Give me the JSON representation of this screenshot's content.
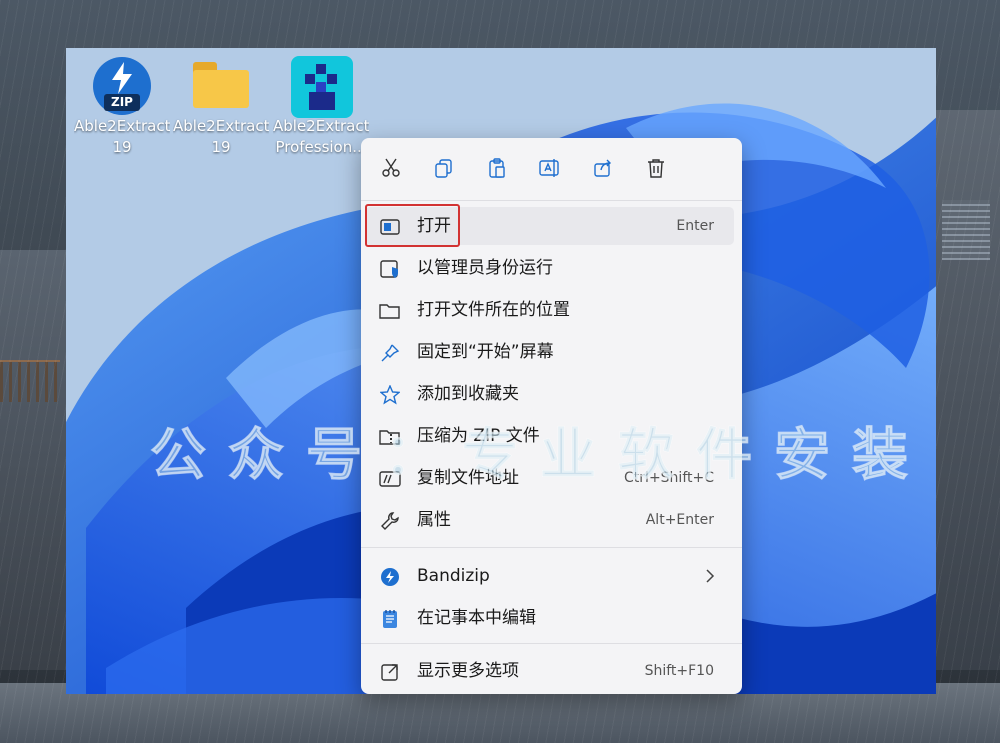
{
  "desktop": {
    "icons": [
      {
        "line1": "Able2Extract",
        "line2": "19"
      },
      {
        "line1": "Able2Extract",
        "line2": "19"
      },
      {
        "line1": "Able2Extract",
        "line2": "Profession..."
      }
    ],
    "zip_badge": "ZIP"
  },
  "context_menu": {
    "toolbar": [
      "cut-icon",
      "copy-icon",
      "paste-icon",
      "rename-icon",
      "share-icon",
      "delete-icon"
    ],
    "items": [
      {
        "label": "打开",
        "shortcut": "Enter",
        "icon": "open-window-icon"
      },
      {
        "label": "以管理员身份运行",
        "icon": "shield-icon"
      },
      {
        "label": "打开文件所在的位置",
        "icon": "folder-icon"
      },
      {
        "label": "固定到“开始”屏幕",
        "icon": "pin-icon"
      },
      {
        "label": "添加到收藏夹",
        "icon": "star-icon"
      },
      {
        "label": "压缩为 ZIP 文件",
        "icon": "zip-icon"
      },
      {
        "label": "复制文件地址",
        "shortcut": "Ctrl+Shift+C",
        "icon": "copy-path-icon"
      },
      {
        "label": "属性",
        "shortcut": "Alt+Enter",
        "icon": "wrench-icon"
      },
      {
        "label": "Bandizip",
        "icon": "bandizip-icon"
      },
      {
        "label": "在记事本中编辑",
        "icon": "notepad-icon"
      },
      {
        "label": "显示更多选项",
        "shortcut": "Shift+F10",
        "icon": "more-options-icon"
      }
    ]
  },
  "watermark": "公众号：专业软件安装",
  "colors": {
    "accent": "#1e6fcf",
    "highlight_box": "#d23232",
    "menu_bg": "#f4f4f6"
  }
}
